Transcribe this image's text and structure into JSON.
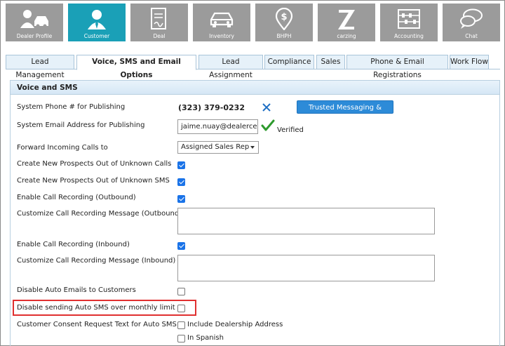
{
  "nav": {
    "tiles": [
      {
        "label": "Dealer Profile",
        "icon": "dealer-profile-icon"
      },
      {
        "label": "Customer",
        "icon": "customer-icon"
      },
      {
        "label": "Deal",
        "icon": "deal-icon"
      },
      {
        "label": "Inventory",
        "icon": "car-icon"
      },
      {
        "label": "BHPH",
        "icon": "dollar-pin-icon"
      },
      {
        "label": "carzing",
        "icon": "carzing-z-icon"
      },
      {
        "label": "Accounting",
        "icon": "abacus-icon"
      },
      {
        "label": "Chat",
        "icon": "chat-bubbles-icon"
      }
    ],
    "active_tile": "Customer"
  },
  "tabs": [
    {
      "label": "Lead Management"
    },
    {
      "label": "Voice, SMS and Email Options"
    },
    {
      "label": "Lead Assignment"
    },
    {
      "label": "Compliance"
    },
    {
      "label": "Sales"
    },
    {
      "label": "Phone & Email Registrations"
    },
    {
      "label": "Work Flow"
    }
  ],
  "active_tab": "Voice, SMS and Email Options",
  "section": {
    "title": "Voice and SMS",
    "system_phone": {
      "label": "System Phone # for Publishing",
      "value": "(323) 379-0232",
      "clear_icon": "close-icon",
      "button_label": "Trusted Messaging & Calling"
    },
    "system_email": {
      "label": "System Email Address for Publishing",
      "value": "jaime.nuay@dealercent",
      "status_icon": "check-icon",
      "status": "Verified"
    },
    "forward_calls": {
      "label": "Forward Incoming Calls to",
      "selected": "Assigned Sales Rep"
    },
    "prospects_calls": {
      "label": "Create New Prospects Out of Unknown Calls",
      "checked": true
    },
    "prospects_sms": {
      "label": "Create New Prospects Out of Unknown SMS",
      "checked": true
    },
    "recording_outbound": {
      "label": "Enable Call Recording (Outbound)",
      "checked": true
    },
    "recording_msg_outbound": {
      "label": "Customize Call Recording Message (Outbound)",
      "value": ""
    },
    "recording_inbound": {
      "label": "Enable Call Recording (Inbound)",
      "checked": true
    },
    "recording_msg_inbound": {
      "label": "Customize Call Recording Message (Inbound)",
      "value": ""
    },
    "disable_auto_emails": {
      "label": "Disable Auto Emails to Customers",
      "checked": false
    },
    "disable_auto_sms": {
      "label": "Disable sending Auto SMS over monthly limit",
      "checked": false,
      "highlight_color": "#e03030"
    },
    "consent_text": {
      "label": "Customer Consent Request Text for Auto SMS",
      "options": [
        {
          "label": "Include Dealership Address",
          "checked": false
        },
        {
          "label": "In Spanish",
          "checked": false
        }
      ]
    }
  },
  "colors": {
    "tile_bg": "#9b9b9b",
    "tile_active_bg": "#1aa0b7",
    "button_blue": "#2d8bd8",
    "checkbox_blue": "#1a73e8"
  }
}
